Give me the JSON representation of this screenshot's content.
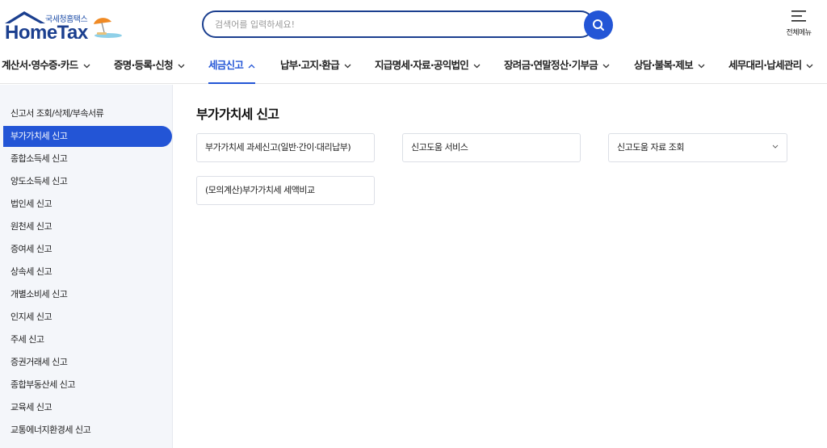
{
  "header": {
    "logo_sub": "국세청홈택스",
    "logo_main": "HomeTax",
    "search_placeholder": "검색어를 입력하세요!",
    "menu_label": "전체메뉴"
  },
  "gnb": {
    "items": [
      {
        "label": "계산서·영수증·카드"
      },
      {
        "label": "증명·등록·신청"
      },
      {
        "label": "세금신고"
      },
      {
        "label": "납부·고지·환급"
      },
      {
        "label": "지급명세·자료·공익법인"
      },
      {
        "label": "장려금·연말정산·기부금"
      },
      {
        "label": "상담·불복·제보"
      },
      {
        "label": "세무대리·납세관리"
      }
    ],
    "active_index": 2
  },
  "sidebar": {
    "items": [
      {
        "label": "신고서 조회/삭제/부속서류"
      },
      {
        "label": "부가가치세 신고"
      },
      {
        "label": "종합소득세 신고"
      },
      {
        "label": "양도소득세 신고"
      },
      {
        "label": "법인세 신고"
      },
      {
        "label": "원천세 신고"
      },
      {
        "label": "증여세 신고"
      },
      {
        "label": "상속세 신고"
      },
      {
        "label": "개별소비세 신고"
      },
      {
        "label": "인지세 신고"
      },
      {
        "label": "주세 신고"
      },
      {
        "label": "증권거래세 신고"
      },
      {
        "label": "종합부동산세 신고"
      },
      {
        "label": "교육세 신고"
      },
      {
        "label": "교통에너지환경세 신고"
      }
    ],
    "active_index": 1
  },
  "main": {
    "title": "부가가치세 신고",
    "cards": [
      {
        "label": "부가가치세 과세신고(일반·간이·대리납부)"
      },
      {
        "label": "신고도움 서비스"
      },
      {
        "label": "신고도움 자료 조회"
      },
      {
        "label": "(모의계산)부가가치세 세액비교"
      }
    ]
  },
  "colors": {
    "accent": "#2355d6",
    "brand": "#1b3f8f",
    "sidebar_bg": "#f4f6fa"
  }
}
